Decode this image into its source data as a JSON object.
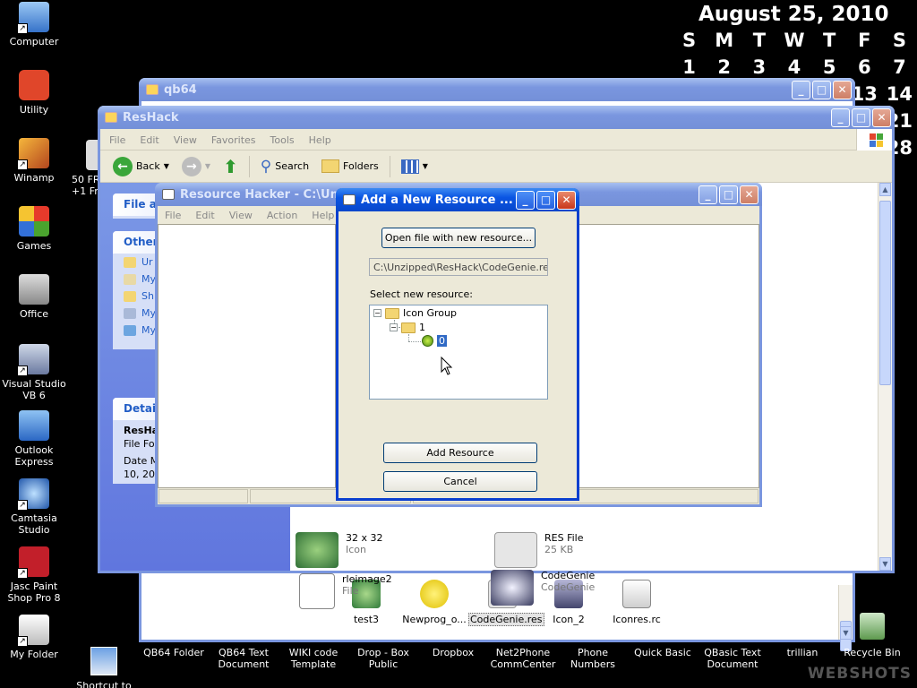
{
  "calendar": {
    "title": "August 25, 2010",
    "weekdays": [
      "S",
      "M",
      "T",
      "W",
      "T",
      "F",
      "S"
    ],
    "row1": [
      "1",
      "2",
      "3",
      "4",
      "5",
      "6",
      "7"
    ],
    "row2_visible": [
      "13",
      "14"
    ],
    "partial": [
      "21",
      "28"
    ]
  },
  "desktop_icons": [
    {
      "label": "Computer"
    },
    {
      "label": "Utility"
    },
    {
      "label": "Winamp"
    },
    {
      "label": "Games"
    },
    {
      "label": "Office"
    },
    {
      "label": "Visual Studio VB 6"
    },
    {
      "label": "Outlook Express"
    },
    {
      "label": "Camtasia Studio"
    },
    {
      "label": "Jasc Paint Shop Pro 8"
    },
    {
      "label": "My Folder"
    }
  ],
  "partial_desktop_icon": {
    "line1": "50 FR",
    "line2": "+1 Fr"
  },
  "bottom_icons": [
    {
      "label": "Shortcut to Unzipped"
    },
    {
      "label": "QB64 Folder"
    },
    {
      "label": "QB64 Text Document"
    },
    {
      "label": "WIKI code Template"
    },
    {
      "label": "Drop - Box Public"
    },
    {
      "label": "Dropbox"
    },
    {
      "label": "Net2Phone CommCenter"
    },
    {
      "label": "Phone Numbers"
    },
    {
      "label": "Quick Basic"
    },
    {
      "label": "QBasic Text Document"
    },
    {
      "label": "trillian"
    },
    {
      "label": "Recycle Bin"
    }
  ],
  "qb64_window": {
    "title": "qb64",
    "files": [
      {
        "label": "test3"
      },
      {
        "label": "Newprog_o..."
      },
      {
        "label": "CodeGenie.res"
      },
      {
        "label": "Icon_2"
      },
      {
        "label": "Iconres.rc"
      }
    ]
  },
  "reshack_window": {
    "title": "ResHack",
    "menu": [
      "File",
      "Edit",
      "View",
      "Favorites",
      "Tools",
      "Help"
    ],
    "toolbar": {
      "back": "Back",
      "search": "Search",
      "folders": "Folders"
    },
    "task_pane": {
      "file_tasks_head": "File ar",
      "other_head": "Other",
      "other_items": [
        "Ur",
        "My",
        "Sh",
        "My",
        "My"
      ],
      "details_head": "Detail",
      "details_name": "ResHa",
      "details_type": "File Fo",
      "details_date1": "Date M",
      "details_date2": "10, 20"
    },
    "files": [
      {
        "name": "32 x 32",
        "sub": "Icon"
      },
      {
        "name": "RES File",
        "sub": "25 KB"
      },
      {
        "name": "rleimage2",
        "sub": "File"
      },
      {
        "name": "CodeGenie",
        "sub": "CodeGenie"
      }
    ]
  },
  "resource_hacker_window": {
    "title": "Resource Hacker   -  C:\\Unzip",
    "menu": [
      "File",
      "Edit",
      "View",
      "Action",
      "Help"
    ]
  },
  "dialog": {
    "title": "Add a New Resource ...",
    "open_button": "Open file with new resource...",
    "path": "C:\\Unzipped\\ResHack\\CodeGenie.res",
    "select_label": "Select new resource:",
    "tree": {
      "root": "Icon Group",
      "child": "1",
      "leaf": "0"
    },
    "add_button": "Add Resource",
    "cancel_button": "Cancel"
  },
  "watermark": "WEBSHOTS"
}
